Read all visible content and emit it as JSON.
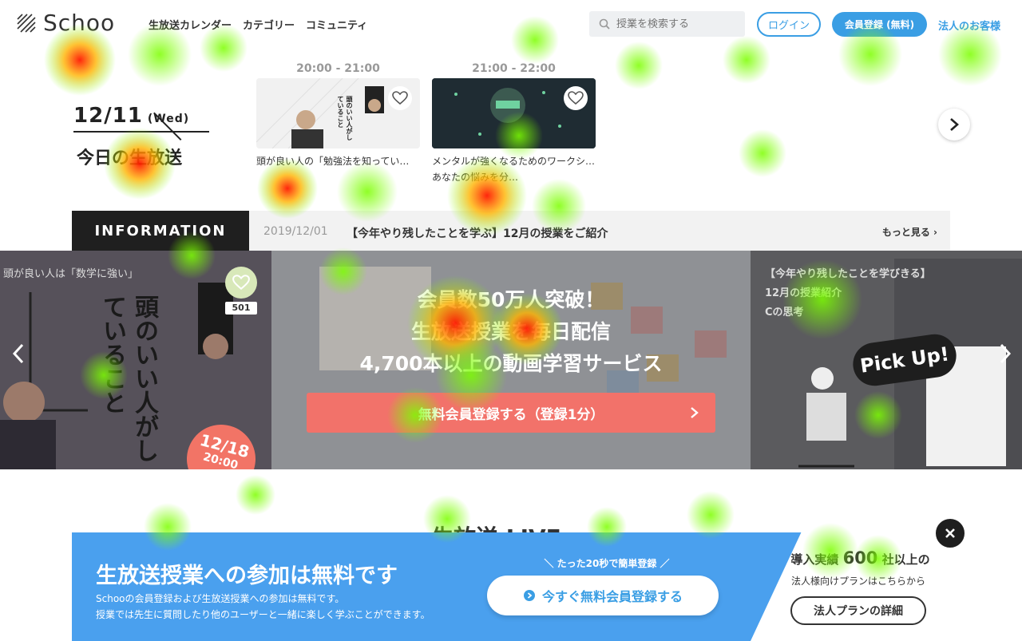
{
  "header": {
    "logo_text": "Schoo",
    "nav": [
      "生放送カレンダー",
      "カテゴリー",
      "コミュニティ"
    ],
    "search_placeholder": "授業を検索する",
    "login_label": "ログイン",
    "register_label": "会員登録 (無料)",
    "corporate_label": "法人のお客様"
  },
  "today": {
    "date": "12/11",
    "dow": "(Wed)",
    "label": "今日の生放送"
  },
  "cards": [
    {
      "time": "20:00 - 21:00",
      "title": "頭が良い人の「勉強法を知ってい…",
      "thumb_text": "頭のいい人がしていること",
      "thumb_color": "#f3f3f3"
    },
    {
      "time": "21:00 - 22:00",
      "title": "メンタルが強くなるためのワークシ…あなたの悩みを分…",
      "thumb_color": "#1f2c33"
    }
  ],
  "information": {
    "label": "INFORMATION",
    "date": "2019/12/01",
    "text": "【今年やり残したことを学ぶ】12月の授業をご紹介",
    "more": "もっと見る"
  },
  "hero": {
    "left_caption": "頭が良い人は「数学に強い」",
    "left_title": "頭のいい人がしていること",
    "like_count": "501",
    "badge_date": "12/18",
    "badge_time": "20:00",
    "line1": "会員数50万人突破！",
    "line2": "生放送授業を毎日配信",
    "line3": "4,700本以上の動画学習サービス",
    "cta": "無料会員登録する（登録1分）",
    "right_caption1": "【今年やり残したことを学びきる】",
    "right_caption2": "12月の授業紹介",
    "right_caption3": "Cの思考",
    "pickup": "Pick Up!"
  },
  "live_heading": "生放送 LIVE",
  "promo": {
    "title": "生放送授業への参加は無料です",
    "sub1": "Schooの会員登録および生放送授業への参加は無料です。",
    "sub2": "授業では先生に質問したり他のユーザーと一緒に楽しく学ぶことができます。",
    "tag": "＼ たった20秒で簡単登録 ／",
    "button": "今すぐ無料会員登録する",
    "corp_prefix": "導入実績",
    "corp_num": "600",
    "corp_suffix": "社以上の",
    "corp_sub": "法人様向けプランはこちらから",
    "corp_button": "法人プランの詳細"
  },
  "colors": {
    "brand_blue": "#3a9ee4",
    "cta_red": "#f2726a",
    "dark": "#1e1e1e"
  },
  "icons": [
    "search-icon",
    "heart-icon",
    "chevron-right-icon",
    "chevron-left-icon",
    "close-icon",
    "play-circle-icon"
  ]
}
